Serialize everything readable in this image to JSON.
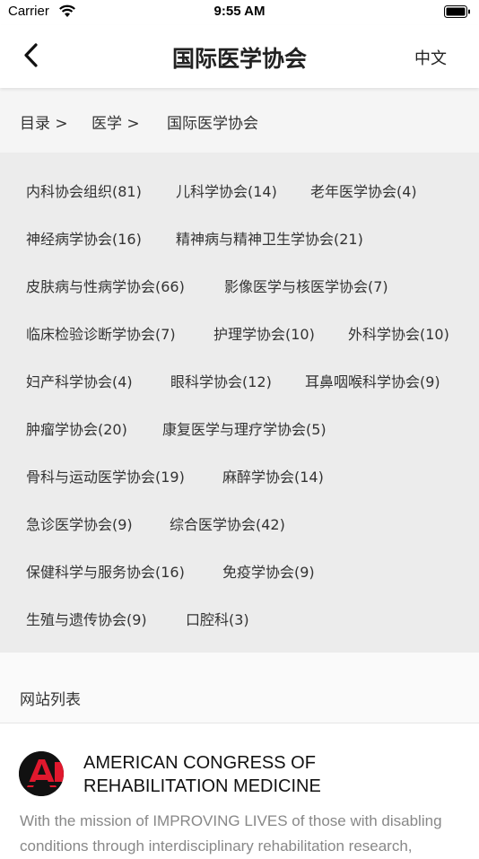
{
  "status_bar": {
    "carrier": "Carrier",
    "time": "9:55 AM"
  },
  "nav": {
    "title": "国际医学协会",
    "language_label": "中文"
  },
  "breadcrumb": {
    "items": [
      "目录 >",
      "医学  >",
      "国际医学协会"
    ]
  },
  "categories": [
    "内科协会组织(81)",
    "儿科学协会(14)",
    "老年医学协会(4)",
    "神经病学协会(16)",
    "精神病与精神卫生学协会(21)",
    "皮肤病与性病学协会(66)",
    "影像医学与核医学协会(7)",
    "临床检验诊断学协会(7)",
    "护理学协会(10)",
    "外科学协会(10)",
    "妇产科学协会(4)",
    "眼科学协会(12)",
    "耳鼻咽喉科学协会(9)",
    "肿瘤学协会(20)",
    "康复医学与理疗学协会(5)",
    "骨科与运动医学协会(19)",
    "麻醉学协会(14)",
    "急诊医学协会(9)",
    "综合医学协会(42)",
    "保健科学与服务协会(16)",
    "免疫学协会(9)",
    "生殖与遗传协会(9)",
    "口腔科(3)"
  ],
  "site_list": {
    "header": "网站列表",
    "items": [
      {
        "name": "AMERICAN CONGRESS OF REHABILITATION MEDICINE",
        "description": "With the mission of IMPROVING LIVES of those with disabling conditions through interdisciplinary rehabilitation research,",
        "logo_color": "#e0182d"
      }
    ]
  },
  "colors": {
    "category_bg": "#ececec",
    "breadcrumb_bg": "#f5f5f5",
    "accent_red": "#e0182d"
  }
}
